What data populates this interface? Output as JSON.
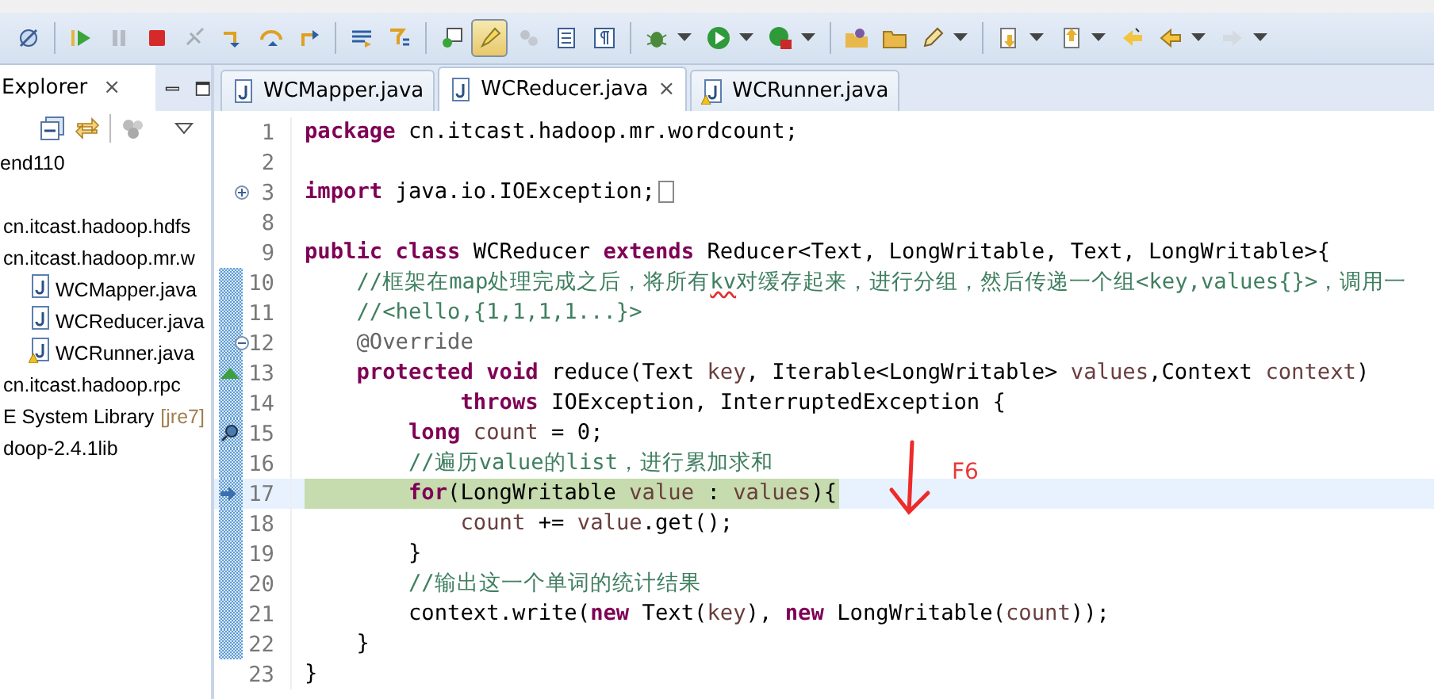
{
  "toolbar": [
    {
      "selected": false,
      "dropdown": false,
      "disabled": false,
      "separator_before": false
    },
    {
      "selected": false,
      "dropdown": false,
      "disabled": false,
      "separator_before": true
    },
    {
      "selected": false,
      "dropdown": false,
      "disabled": true,
      "separator_before": false
    },
    {
      "selected": false,
      "dropdown": false,
      "disabled": false,
      "separator_before": false
    },
    {
      "selected": false,
      "dropdown": false,
      "disabled": true,
      "separator_before": false
    },
    {
      "selected": false,
      "dropdown": false,
      "disabled": false,
      "separator_before": false
    },
    {
      "selected": false,
      "dropdown": false,
      "disabled": false,
      "separator_before": false
    },
    {
      "selected": false,
      "dropdown": false,
      "disabled": false,
      "separator_before": false
    },
    {
      "selected": false,
      "dropdown": false,
      "disabled": false,
      "separator_before": true
    },
    {
      "selected": false,
      "dropdown": false,
      "disabled": false,
      "separator_before": false
    },
    {
      "selected": false,
      "dropdown": false,
      "disabled": false,
      "separator_before": true
    },
    {
      "selected": true,
      "dropdown": false,
      "disabled": false,
      "separator_before": false
    },
    {
      "selected": false,
      "dropdown": false,
      "disabled": true,
      "separator_before": false
    },
    {
      "selected": false,
      "dropdown": false,
      "disabled": false,
      "separator_before": false
    },
    {
      "selected": false,
      "dropdown": false,
      "disabled": false,
      "separator_before": false
    },
    {
      "selected": false,
      "dropdown": true,
      "disabled": false,
      "separator_before": true
    },
    {
      "selected": false,
      "dropdown": true,
      "disabled": false,
      "separator_before": false
    },
    {
      "selected": false,
      "dropdown": true,
      "disabled": false,
      "separator_before": false
    },
    {
      "selected": false,
      "dropdown": false,
      "disabled": false,
      "separator_before": true
    },
    {
      "selected": false,
      "dropdown": false,
      "disabled": false,
      "separator_before": false
    },
    {
      "selected": false,
      "dropdown": true,
      "disabled": false,
      "separator_before": false
    },
    {
      "selected": false,
      "dropdown": true,
      "disabled": false,
      "separator_before": true
    },
    {
      "selected": false,
      "dropdown": true,
      "disabled": false,
      "separator_before": false
    },
    {
      "selected": false,
      "dropdown": false,
      "disabled": false,
      "separator_before": false
    },
    {
      "selected": false,
      "dropdown": true,
      "disabled": false,
      "separator_before": false
    },
    {
      "selected": false,
      "dropdown": true,
      "disabled": true,
      "separator_before": false
    }
  ],
  "explorer": {
    "title": "Explorer",
    "close": "×",
    "tree": [
      {
        "label": "end110",
        "kind": "project"
      },
      {
        "label": "cn.itcast.hadoop.hdfs",
        "kind": "package"
      },
      {
        "label": "cn.itcast.hadoop.mr.w",
        "kind": "package",
        "children": [
          {
            "label": "WCMapper.java",
            "kind": "file",
            "warning": false
          },
          {
            "label": "WCReducer.java",
            "kind": "file",
            "warning": false
          },
          {
            "label": "WCRunner.java",
            "kind": "file",
            "warning": true
          }
        ]
      },
      {
        "label": "cn.itcast.hadoop.rpc",
        "kind": "package"
      },
      {
        "label": "E System Library",
        "suffix": "[jre7]",
        "kind": "library"
      },
      {
        "label": "doop-2.4.1lib",
        "kind": "library"
      }
    ]
  },
  "editor_tabs": [
    {
      "label": "WCMapper.java",
      "selected": false,
      "warning": false
    },
    {
      "label": "WCReducer.java",
      "selected": true,
      "warning": false,
      "close": "×"
    },
    {
      "label": "WCRunner.java",
      "selected": false,
      "warning": true
    }
  ],
  "lines": [
    {
      "number": "1",
      "in_range": false,
      "current": false,
      "folded": false,
      "tokens": [
        {
          "kind": "keyword",
          "text": "package"
        },
        {
          "kind": "plain",
          "text": " cn.itcast.hadoop.mr.wordcount;"
        }
      ]
    },
    {
      "number": "2",
      "in_range": false,
      "current": false,
      "folded": false
    },
    {
      "number": "3",
      "gutter": {
        "kind": "expand"
      },
      "in_range": false,
      "current": false,
      "folded": true,
      "tokens": [
        {
          "kind": "keyword",
          "text": "import"
        },
        {
          "kind": "plain",
          "text": " java.io.IOException;"
        }
      ]
    },
    {
      "number": "8",
      "in_range": false,
      "current": false,
      "folded": false
    },
    {
      "number": "9",
      "in_range": false,
      "current": false,
      "folded": false,
      "tokens": [
        {
          "kind": "keyword",
          "text": "public class"
        },
        {
          "kind": "plain",
          "text": " WCReducer "
        },
        {
          "kind": "keyword",
          "text": "extends"
        },
        {
          "kind": "plain",
          "text": " Reducer<Text, LongWritable, Text, LongWritable>{"
        }
      ]
    },
    {
      "number": "10",
      "in_range": true,
      "current": false,
      "folded": false,
      "tokens": [
        {
          "kind": "comment",
          "text": "    //框架在map处理完成之后，将所有"
        },
        {
          "kind": "misspelled",
          "text": "kv"
        },
        {
          "kind": "comment",
          "text": "对缓存起来，进行分组，然后传递一个组<key,values{}>，调用一"
        }
      ]
    },
    {
      "number": "11",
      "in_range": true,
      "current": false,
      "folded": false,
      "tokens": [
        {
          "kind": "comment",
          "text": "    //<hello,{1,1,1,1...}>"
        }
      ]
    },
    {
      "number": "12",
      "gutter": {
        "kind": "collapse"
      },
      "in_range": true,
      "current": false,
      "folded": false,
      "tokens": [
        {
          "kind": "annotation",
          "text": "    @Override"
        }
      ]
    },
    {
      "number": "13",
      "gutter": {
        "kind": "override"
      },
      "in_range": true,
      "current": false,
      "folded": false,
      "tokens": [
        {
          "kind": "keyword",
          "text": "    protected void"
        },
        {
          "kind": "plain",
          "text": " reduce(Text "
        },
        {
          "kind": "variable",
          "text": "key"
        },
        {
          "kind": "plain",
          "text": ", Iterable<LongWritable> "
        },
        {
          "kind": "variable",
          "text": "values"
        },
        {
          "kind": "plain",
          "text": ",Context "
        },
        {
          "kind": "variable",
          "text": "context"
        },
        {
          "kind": "plain",
          "text": ")"
        }
      ]
    },
    {
      "number": "14",
      "in_range": true,
      "current": false,
      "folded": false,
      "tokens": [
        {
          "kind": "keyword",
          "text": "            throws"
        },
        {
          "kind": "plain",
          "text": " IOException, InterruptedException {"
        }
      ]
    },
    {
      "number": "15",
      "gutter": {
        "kind": "search"
      },
      "in_range": true,
      "current": false,
      "folded": false,
      "tokens": [
        {
          "kind": "keyword",
          "text": "        long "
        },
        {
          "kind": "variable",
          "text": "count"
        },
        {
          "kind": "plain",
          "text": " = 0;"
        }
      ]
    },
    {
      "number": "16",
      "in_range": true,
      "current": false,
      "folded": false,
      "tokens": [
        {
          "kind": "comment",
          "text": "        //遍历value的list，进行累加求和"
        }
      ]
    },
    {
      "number": "17",
      "gutter": {
        "kind": "instruction"
      },
      "in_range": true,
      "current": true,
      "folded": false,
      "tokens": [
        {
          "kind": "keyword",
          "text": "        for"
        },
        {
          "kind": "plain",
          "text": "(LongWritable "
        },
        {
          "kind": "variable",
          "text": "value"
        },
        {
          "kind": "plain",
          "text": " : "
        },
        {
          "kind": "variable",
          "text": "values"
        },
        {
          "kind": "plain",
          "text": "){"
        }
      ]
    },
    {
      "number": "18",
      "in_range": true,
      "current": false,
      "folded": false,
      "tokens": [
        {
          "kind": "variable",
          "text": "            count"
        },
        {
          "kind": "plain",
          "text": " += "
        },
        {
          "kind": "variable",
          "text": "value"
        },
        {
          "kind": "plain",
          "text": ".get();"
        }
      ]
    },
    {
      "number": "19",
      "in_range": true,
      "current": false,
      "folded": false,
      "tokens": [
        {
          "kind": "plain",
          "text": "        }"
        }
      ]
    },
    {
      "number": "20",
      "in_range": true,
      "current": false,
      "folded": false,
      "tokens": [
        {
          "kind": "comment",
          "text": "        //输出这一个单词的统计结果"
        }
      ]
    },
    {
      "number": "21",
      "in_range": true,
      "current": false,
      "folded": false,
      "tokens": [
        {
          "kind": "plain",
          "text": "        context.write("
        },
        {
          "kind": "keyword",
          "text": "new"
        },
        {
          "kind": "plain",
          "text": " Text("
        },
        {
          "kind": "variable",
          "text": "key"
        },
        {
          "kind": "plain",
          "text": "), "
        },
        {
          "kind": "keyword",
          "text": "new"
        },
        {
          "kind": "plain",
          "text": " LongWritable("
        },
        {
          "kind": "variable",
          "text": "count"
        },
        {
          "kind": "plain",
          "text": "));"
        }
      ]
    },
    {
      "number": "22",
      "in_range": true,
      "current": false,
      "folded": false,
      "tokens": [
        {
          "kind": "plain",
          "text": "    }"
        }
      ]
    },
    {
      "number": "23",
      "in_range": false,
      "current": false,
      "folded": false,
      "tokens": [
        {
          "kind": "plain",
          "text": "}"
        }
      ]
    }
  ],
  "annotation": {
    "label": "F6"
  }
}
